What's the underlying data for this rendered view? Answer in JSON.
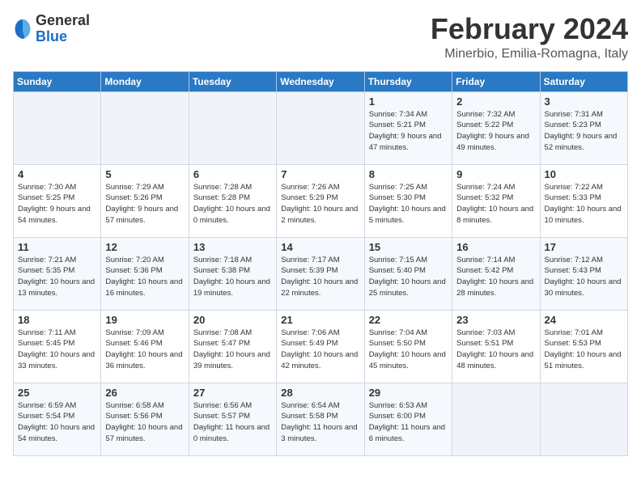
{
  "header": {
    "logo_general": "General",
    "logo_blue": "Blue",
    "month_title": "February 2024",
    "location": "Minerbio, Emilia-Romagna, Italy"
  },
  "days_of_week": [
    "Sunday",
    "Monday",
    "Tuesday",
    "Wednesday",
    "Thursday",
    "Friday",
    "Saturday"
  ],
  "weeks": [
    [
      {
        "day": "",
        "info": ""
      },
      {
        "day": "",
        "info": ""
      },
      {
        "day": "",
        "info": ""
      },
      {
        "day": "",
        "info": ""
      },
      {
        "day": "1",
        "info": "Sunrise: 7:34 AM\nSunset: 5:21 PM\nDaylight: 9 hours and 47 minutes."
      },
      {
        "day": "2",
        "info": "Sunrise: 7:32 AM\nSunset: 5:22 PM\nDaylight: 9 hours and 49 minutes."
      },
      {
        "day": "3",
        "info": "Sunrise: 7:31 AM\nSunset: 5:23 PM\nDaylight: 9 hours and 52 minutes."
      }
    ],
    [
      {
        "day": "4",
        "info": "Sunrise: 7:30 AM\nSunset: 5:25 PM\nDaylight: 9 hours and 54 minutes."
      },
      {
        "day": "5",
        "info": "Sunrise: 7:29 AM\nSunset: 5:26 PM\nDaylight: 9 hours and 57 minutes."
      },
      {
        "day": "6",
        "info": "Sunrise: 7:28 AM\nSunset: 5:28 PM\nDaylight: 10 hours and 0 minutes."
      },
      {
        "day": "7",
        "info": "Sunrise: 7:26 AM\nSunset: 5:29 PM\nDaylight: 10 hours and 2 minutes."
      },
      {
        "day": "8",
        "info": "Sunrise: 7:25 AM\nSunset: 5:30 PM\nDaylight: 10 hours and 5 minutes."
      },
      {
        "day": "9",
        "info": "Sunrise: 7:24 AM\nSunset: 5:32 PM\nDaylight: 10 hours and 8 minutes."
      },
      {
        "day": "10",
        "info": "Sunrise: 7:22 AM\nSunset: 5:33 PM\nDaylight: 10 hours and 10 minutes."
      }
    ],
    [
      {
        "day": "11",
        "info": "Sunrise: 7:21 AM\nSunset: 5:35 PM\nDaylight: 10 hours and 13 minutes."
      },
      {
        "day": "12",
        "info": "Sunrise: 7:20 AM\nSunset: 5:36 PM\nDaylight: 10 hours and 16 minutes."
      },
      {
        "day": "13",
        "info": "Sunrise: 7:18 AM\nSunset: 5:38 PM\nDaylight: 10 hours and 19 minutes."
      },
      {
        "day": "14",
        "info": "Sunrise: 7:17 AM\nSunset: 5:39 PM\nDaylight: 10 hours and 22 minutes."
      },
      {
        "day": "15",
        "info": "Sunrise: 7:15 AM\nSunset: 5:40 PM\nDaylight: 10 hours and 25 minutes."
      },
      {
        "day": "16",
        "info": "Sunrise: 7:14 AM\nSunset: 5:42 PM\nDaylight: 10 hours and 28 minutes."
      },
      {
        "day": "17",
        "info": "Sunrise: 7:12 AM\nSunset: 5:43 PM\nDaylight: 10 hours and 30 minutes."
      }
    ],
    [
      {
        "day": "18",
        "info": "Sunrise: 7:11 AM\nSunset: 5:45 PM\nDaylight: 10 hours and 33 minutes."
      },
      {
        "day": "19",
        "info": "Sunrise: 7:09 AM\nSunset: 5:46 PM\nDaylight: 10 hours and 36 minutes."
      },
      {
        "day": "20",
        "info": "Sunrise: 7:08 AM\nSunset: 5:47 PM\nDaylight: 10 hours and 39 minutes."
      },
      {
        "day": "21",
        "info": "Sunrise: 7:06 AM\nSunset: 5:49 PM\nDaylight: 10 hours and 42 minutes."
      },
      {
        "day": "22",
        "info": "Sunrise: 7:04 AM\nSunset: 5:50 PM\nDaylight: 10 hours and 45 minutes."
      },
      {
        "day": "23",
        "info": "Sunrise: 7:03 AM\nSunset: 5:51 PM\nDaylight: 10 hours and 48 minutes."
      },
      {
        "day": "24",
        "info": "Sunrise: 7:01 AM\nSunset: 5:53 PM\nDaylight: 10 hours and 51 minutes."
      }
    ],
    [
      {
        "day": "25",
        "info": "Sunrise: 6:59 AM\nSunset: 5:54 PM\nDaylight: 10 hours and 54 minutes."
      },
      {
        "day": "26",
        "info": "Sunrise: 6:58 AM\nSunset: 5:56 PM\nDaylight: 10 hours and 57 minutes."
      },
      {
        "day": "27",
        "info": "Sunrise: 6:56 AM\nSunset: 5:57 PM\nDaylight: 11 hours and 0 minutes."
      },
      {
        "day": "28",
        "info": "Sunrise: 6:54 AM\nSunset: 5:58 PM\nDaylight: 11 hours and 3 minutes."
      },
      {
        "day": "29",
        "info": "Sunrise: 6:53 AM\nSunset: 6:00 PM\nDaylight: 11 hours and 6 minutes."
      },
      {
        "day": "",
        "info": ""
      },
      {
        "day": "",
        "info": ""
      }
    ]
  ]
}
